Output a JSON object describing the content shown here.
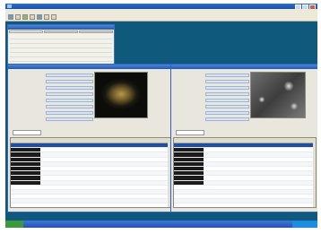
{
  "app": {
    "title": "",
    "menus": [
      "",
      "",
      "",
      "",
      ""
    ]
  },
  "explorer": {
    "title": "",
    "tabs": [
      "",
      "",
      ""
    ],
    "rows": [
      [
        "",
        ""
      ],
      [
        "",
        ""
      ],
      [
        "",
        ""
      ],
      [
        "",
        ""
      ],
      [
        "",
        ""
      ],
      [
        "",
        ""
      ],
      [
        "",
        ""
      ]
    ]
  },
  "camera_left": {
    "title": "",
    "props": [
      [
        "",
        ""
      ],
      [
        "",
        ""
      ],
      [
        "",
        ""
      ],
      [
        "",
        ""
      ],
      [
        "",
        ""
      ],
      [
        "",
        ""
      ],
      [
        "",
        ""
      ],
      [
        "",
        ""
      ]
    ],
    "filter_label": "",
    "columns": [
      "",
      "",
      "",
      "",
      "",
      ""
    ],
    "rows": [
      [
        "",
        "",
        "",
        "",
        "",
        ""
      ],
      [
        "",
        "",
        "",
        "",
        "",
        ""
      ],
      [
        "",
        "",
        "",
        "",
        "",
        ""
      ],
      [
        "",
        "",
        "",
        "",
        "",
        ""
      ],
      [
        "",
        "",
        "",
        "",
        "",
        ""
      ],
      [
        "",
        "",
        "",
        "",
        "",
        ""
      ],
      [
        "",
        "",
        "",
        "",
        "",
        ""
      ],
      [
        "",
        "",
        "",
        "",
        "",
        ""
      ],
      [
        "",
        "",
        "",
        "",
        "",
        ""
      ],
      [
        "",
        "",
        "",
        "",
        "",
        ""
      ],
      [
        "",
        "",
        "",
        "",
        "",
        ""
      ],
      [
        "",
        "",
        "",
        "",
        "",
        ""
      ],
      [
        "",
        "",
        "",
        "",
        "",
        ""
      ],
      [
        "",
        "",
        "",
        "",
        "",
        ""
      ],
      [
        "",
        "",
        "",
        "",
        "",
        ""
      ],
      [
        "",
        "",
        "",
        "",
        "",
        ""
      ]
    ]
  },
  "camera_right": {
    "title": "",
    "props": [
      [
        "",
        ""
      ],
      [
        "",
        ""
      ],
      [
        "",
        ""
      ],
      [
        "",
        ""
      ],
      [
        "",
        ""
      ],
      [
        "",
        ""
      ],
      [
        "",
        ""
      ],
      [
        "",
        ""
      ]
    ],
    "filter_label": "",
    "columns": [
      "",
      "",
      "",
      "",
      "",
      ""
    ],
    "rows": [
      [
        "",
        "",
        "",
        "",
        "",
        ""
      ],
      [
        "",
        "",
        "",
        "",
        "",
        ""
      ],
      [
        "",
        "",
        "",
        "",
        "",
        ""
      ],
      [
        "",
        "",
        "",
        "",
        "",
        ""
      ],
      [
        "",
        "",
        "",
        "",
        "",
        ""
      ],
      [
        "",
        "",
        "",
        "",
        "",
        ""
      ],
      [
        "",
        "",
        "",
        "",
        "",
        ""
      ],
      [
        "",
        "",
        "",
        "",
        "",
        ""
      ],
      [
        "",
        "",
        "",
        "",
        "",
        ""
      ],
      [
        "",
        "",
        "",
        "",
        "",
        ""
      ],
      [
        "",
        "",
        "",
        "",
        "",
        ""
      ],
      [
        "",
        "",
        "",
        "",
        "",
        ""
      ],
      [
        "",
        "",
        "",
        "",
        "",
        ""
      ],
      [
        "",
        "",
        "",
        "",
        "",
        ""
      ],
      [
        "",
        "",
        "",
        "",
        "",
        ""
      ],
      [
        "",
        "",
        "",
        "",
        "",
        ""
      ]
    ]
  },
  "taskbar": {
    "start_label": "",
    "clock": ""
  },
  "colors": {
    "desktop": "#0f5a7c",
    "titlebar": "#2457b5",
    "selection": "#1e4fa8"
  }
}
